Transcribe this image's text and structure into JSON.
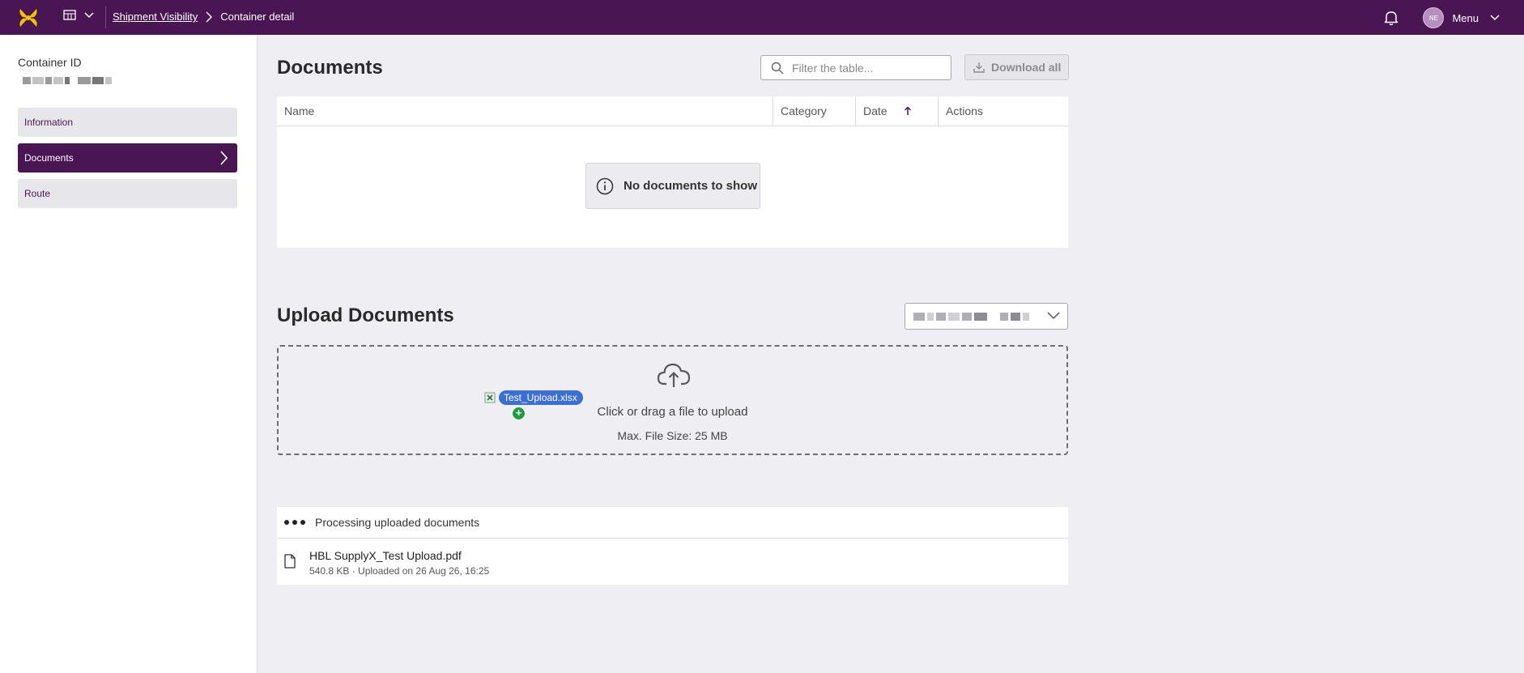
{
  "topbar": {
    "breadcrumb_parent": "Shipment Visibility",
    "breadcrumb_current": "Container detail",
    "avatar_initials": "NE",
    "menu_label": "Menu",
    "brand_color": "#4a1553",
    "logo_color": "#f2c200"
  },
  "sidebar": {
    "container_id_label": "Container ID",
    "items": [
      {
        "label": "Information",
        "active": false
      },
      {
        "label": "Documents",
        "active": true
      },
      {
        "label": "Route",
        "active": false
      }
    ]
  },
  "documents": {
    "title": "Documents",
    "filter_placeholder": "Filter the table...",
    "download_all_label": "Download all",
    "columns": [
      "Name",
      "Category",
      "Date",
      "Actions"
    ],
    "sorted_column": "Date",
    "sort_direction": "ascending",
    "empty_message": "No documents to show"
  },
  "upload": {
    "title": "Upload Documents",
    "dropzone_text": "Click or drag a file to upload",
    "max_size_text": "Max. File Size: 25 MB",
    "dragging_file": "Test_Upload.xlsx"
  },
  "processing": {
    "header": "Processing uploaded documents",
    "file": {
      "name": "HBL SupplyX_Test Upload.pdf",
      "meta": "540.8 KB · Uploaded on 26 Aug 26, 16:25"
    }
  }
}
